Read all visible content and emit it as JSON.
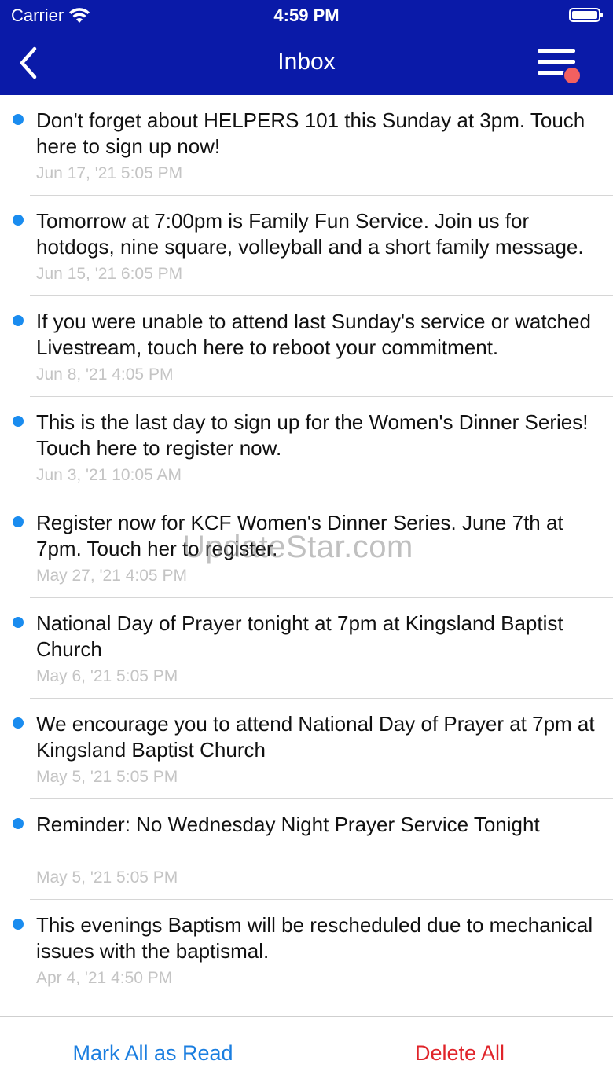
{
  "status_bar": {
    "carrier": "Carrier",
    "time": "4:59 PM"
  },
  "nav": {
    "title": "Inbox",
    "back_icon": "chevron-left-icon",
    "menu_icon": "menu-icon",
    "has_notification_badge": true
  },
  "messages": [
    {
      "text": "Don't forget about HELPERS 101 this Sunday at 3pm.  Touch here to sign up now!",
      "date": "Jun 17, '21 5:05 PM",
      "unread": true
    },
    {
      "text": "Tomorrow at 7:00pm is Family Fun Service.  Join us for hotdogs, nine square, volleyball and a short family message.",
      "date": "Jun 15, '21 6:05 PM",
      "unread": true
    },
    {
      "text": "If you were unable to attend last Sunday's service or watched Livestream, touch here to reboot your commitment.",
      "date": "Jun 8, '21 4:05 PM",
      "unread": true
    },
    {
      "text": "This is the last day to sign up for the Women's Dinner Series!  Touch here to register now.",
      "date": "Jun 3, '21 10:05 AM",
      "unread": true
    },
    {
      "text": "Register now for KCF Women's Dinner Series.  June 7th at 7pm.  Touch her to register.",
      "date": "May 27, '21 4:05 PM",
      "unread": true
    },
    {
      "text": "National Day of Prayer tonight at 7pm at Kingsland Baptist Church",
      "date": "May 6, '21 5:05 PM",
      "unread": true
    },
    {
      "text": "We encourage you to attend National Day of Prayer at 7pm at Kingsland Baptist Church",
      "date": "May 5, '21 5:05 PM",
      "unread": true
    },
    {
      "text": "Reminder: No Wednesday Night Prayer Service Tonight",
      "date": "May 5, '21 5:05 PM",
      "unread": true
    },
    {
      "text": "This evenings Baptism will be rescheduled due to mechanical issues with the baptismal.",
      "date": "Apr 4, '21 4:50 PM",
      "unread": true
    }
  ],
  "watermark": "UpdateStar.com",
  "footer": {
    "mark_all_read": "Mark All as Read",
    "delete_all": "Delete All"
  },
  "colors": {
    "header": "#0a1aa8",
    "unread_dot": "#1a8cef",
    "badge": "#f26060",
    "mark_read": "#1a7ee0",
    "delete": "#e0242a"
  }
}
